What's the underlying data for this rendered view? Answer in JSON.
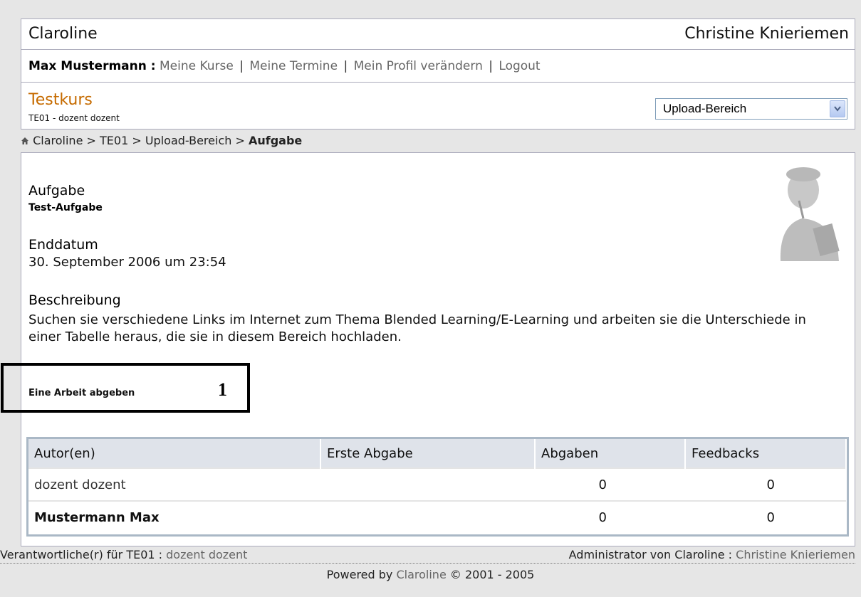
{
  "header": {
    "site_name": "Claroline",
    "admin_name": "Christine Knieriemen"
  },
  "userbar": {
    "user_name": "Max Mustermann :",
    "links": [
      "Meine Kurse",
      "Meine Termine",
      "Mein Profil verändern",
      "Logout"
    ],
    "separator": "|"
  },
  "course": {
    "title": "Testkurs",
    "subtitle": "TE01 - dozent dozent",
    "tool_select": "Upload-Bereich"
  },
  "breadcrumb": {
    "items": [
      "Claroline",
      "TE01",
      "Upload-Bereich"
    ],
    "current": "Aufgabe",
    "separator": ">"
  },
  "assignment": {
    "title_label": "Aufgabe",
    "title_value": "Test-Aufgabe",
    "end_label": "Enddatum",
    "end_value": "30. September 2006 um 23:54",
    "desc_label": "Beschreibung",
    "desc_value": "Suchen sie verschiedene Links im Internet zum Thema Blended Learning/E-Learning und arbeiten sie die Unterschiede in einer Tabelle heraus, die sie in diesem Bereich hochladen.",
    "submit_link": "Eine Arbeit abgeben",
    "marker": "1"
  },
  "table": {
    "headers": [
      "Autor(en)",
      "Erste Abgabe",
      "Abgaben",
      "Feedbacks"
    ],
    "rows": [
      {
        "author": "dozent dozent",
        "first": "",
        "submissions": "0",
        "feedbacks": "0"
      },
      {
        "author": "Mustermann Max",
        "first": "",
        "submissions": "0",
        "feedbacks": "0"
      }
    ]
  },
  "footer": {
    "manager_label": "Verantwortliche(r) für TE01 :",
    "manager_name": "dozent dozent",
    "admin_label": "Administrator von Claroline :",
    "admin_name": "Christine Knieriemen",
    "powered_prefix": "Powered by",
    "powered_link": "Claroline",
    "powered_suffix": "© 2001 - 2005"
  },
  "colors": {
    "course_title": "#c66b00",
    "background": "#e6e6e6",
    "table_header": "#dfe3ea"
  },
  "icons": [
    "home-icon",
    "chevron-down-icon"
  ]
}
